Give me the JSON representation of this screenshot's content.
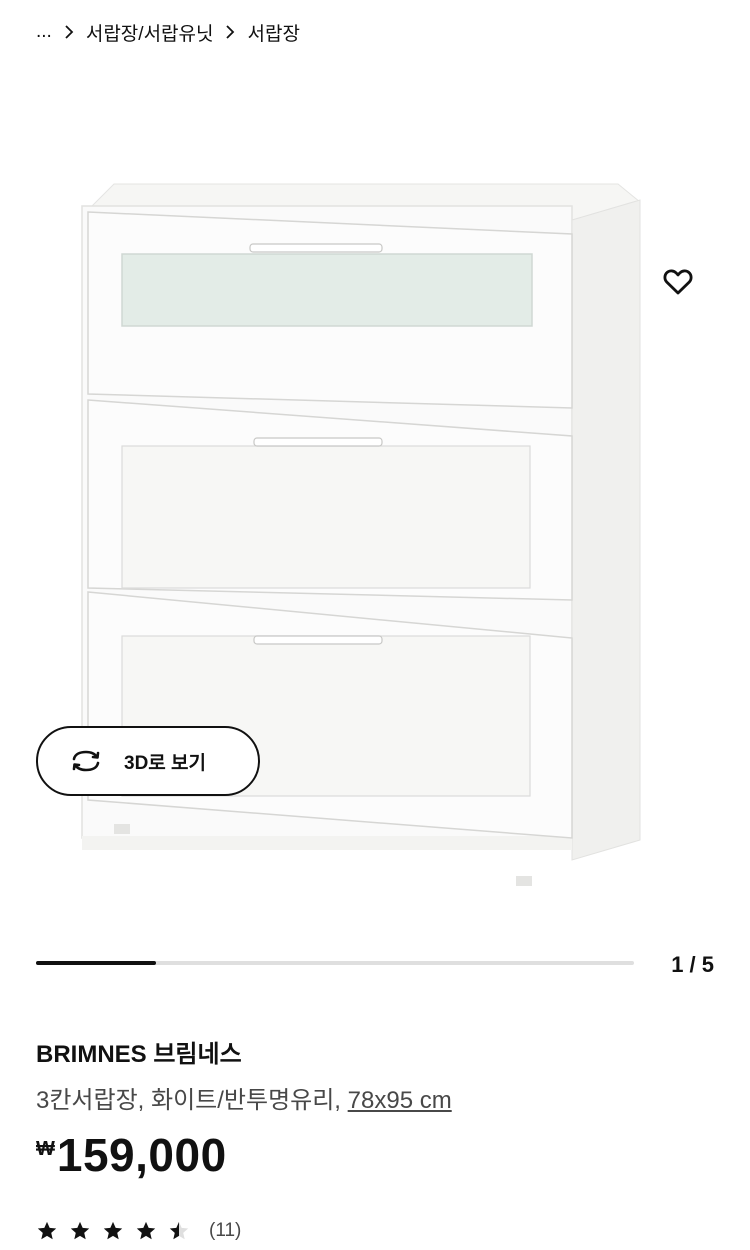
{
  "breadcrumb": {
    "ellipsis": "...",
    "items": [
      "서랍장/서랍유닛",
      "서랍장"
    ]
  },
  "gallery": {
    "view3d_label": "3D로 보기",
    "current_page": 1,
    "total_pages": 5,
    "counter": "1 / 5",
    "progress_fraction": 0.2
  },
  "product": {
    "name": "BRIMNES 브림네스",
    "description": "3칸서랍장, 화이트/반투명유리,",
    "size": "78x95 cm"
  },
  "price": {
    "currency": "₩",
    "amount": "159,000"
  },
  "rating": {
    "stars": 4.5,
    "max_stars": 5,
    "review_count": "(11)"
  },
  "icons": {
    "favorite": "heart-outline-icon",
    "view3d": "rotate-arrows-icon",
    "breadcrumb_separator": "chevron-right-icon",
    "rating": "star-icon"
  },
  "colors": {
    "text": "#111111",
    "secondary_text": "#484848",
    "progress_track": "#dfdfdf",
    "frosted_glass": "#e3ece7"
  }
}
